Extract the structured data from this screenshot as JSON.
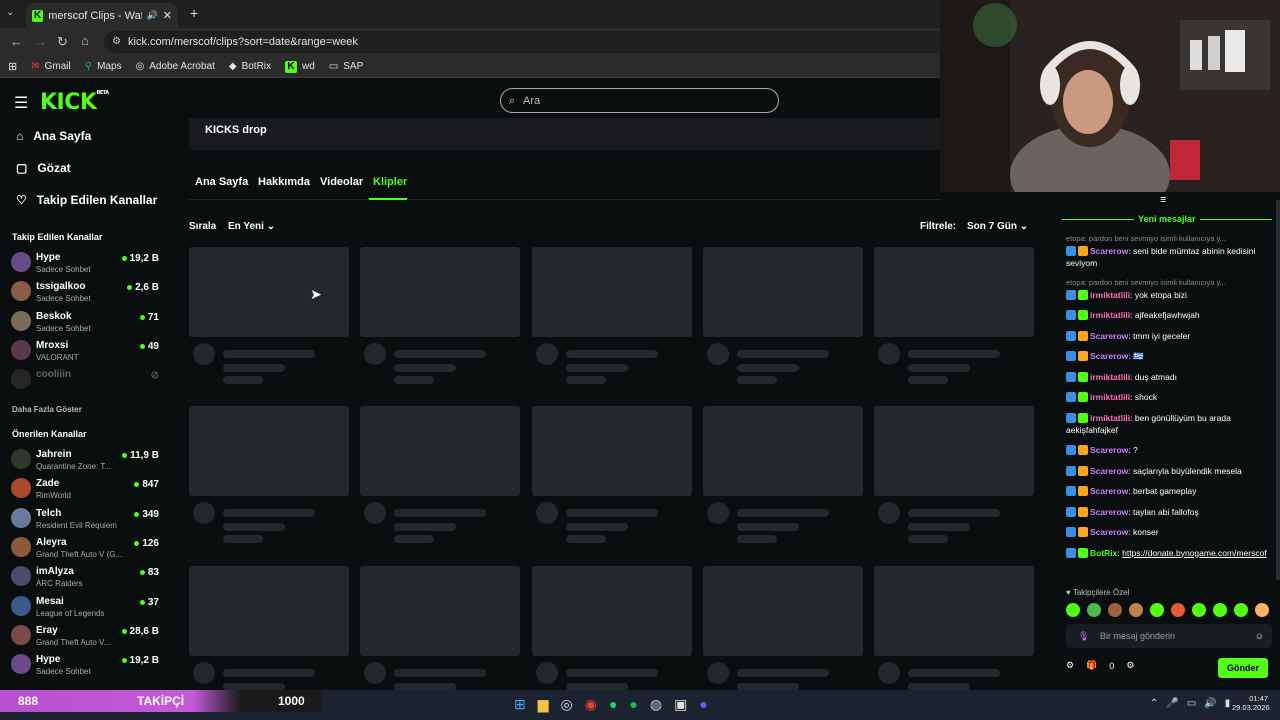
{
  "browser": {
    "tab_title": "merscof Clips - Watch Live",
    "url": "kick.com/merscof/clips?sort=date&range=week",
    "bookmarks": [
      "Gmail",
      "Maps",
      "Adobe Acrobat",
      "BotRix",
      "wd",
      "SAP"
    ]
  },
  "header": {
    "logo": "KICK",
    "logo_badge": "BETA",
    "search_placeholder": "Ara"
  },
  "sidebar": {
    "nav": [
      "Ana Sayfa",
      "Gözat",
      "Takip Edilen Kanallar"
    ],
    "followed_title": "Takip Edilen Kanallar",
    "followed": [
      {
        "name": "Hype",
        "game": "Sadece Sohbet",
        "viewers": "19,2 B",
        "color": "#6b4a8a"
      },
      {
        "name": "tssigalkoo",
        "game": "Sadece Sohbet",
        "viewers": "2,6 B",
        "color": "#8a5a4a"
      },
      {
        "name": "Beskok",
        "game": "Sadece Sohbet",
        "viewers": "71",
        "color": "#7a6a5a"
      },
      {
        "name": "Mroxsi",
        "game": "VALORANT",
        "viewers": "49",
        "color": "#5a3a4a"
      },
      {
        "name": "cooliiin",
        "game": "",
        "viewers": "",
        "color": "#555555"
      }
    ],
    "show_more": "Daha Fazla Göster",
    "recommended_title": "Önerilen Kanallar",
    "recommended": [
      {
        "name": "Jahrein",
        "game": "Quarantine Zone: T...",
        "viewers": "11,9 B",
        "color": "#2a3a2a"
      },
      {
        "name": "Zade",
        "game": "RimWorld",
        "viewers": "847",
        "color": "#aa4a2a"
      },
      {
        "name": "Telch",
        "game": "Resident Evil Requiem",
        "viewers": "349",
        "color": "#6a7a9a"
      },
      {
        "name": "Aleyra",
        "game": "Grand Theft Auto V (G...",
        "viewers": "126",
        "color": "#8a5a3a"
      },
      {
        "name": "imAlyza",
        "game": "ARC Raiders",
        "viewers": "83",
        "color": "#4a4a6a"
      },
      {
        "name": "Mesai",
        "game": "League of Legends",
        "viewers": "37",
        "color": "#3a5a8a"
      },
      {
        "name": "Eray",
        "game": "Grand Theft Auto V...",
        "viewers": "28,6 B",
        "color": "#7a4a4a"
      },
      {
        "name": "Hype",
        "game": "Sadece Sohbet",
        "viewers": "19,2 B",
        "color": "#6b4a8a"
      }
    ]
  },
  "main": {
    "kicks_drop": "KICKS drop",
    "tabs": [
      "Ana Sayfa",
      "Hakkımda",
      "Videolar",
      "Klipler"
    ],
    "sort_label": "Sırala",
    "sort_value": "En Yeni",
    "filter_label": "Filtrele:",
    "filter_value": "Son 7 Gün"
  },
  "chat": {
    "new_messages": "Yeni mesajlar",
    "messages": [
      {
        "reply": "etopa: pardon beni sevmiyo isimli kullanıcıya y...",
        "user": "Scarerow",
        "color": "#c77dff",
        "text": "seni bide mümtaz abinin kedisini seviyom"
      },
      {
        "reply": "etopa: pardon beni sevmiyo isimli kullanıcıya y...",
        "user": "irmiktatlili",
        "color": "#ff6fb5",
        "text": "yok etopa bizi"
      },
      {
        "user": "irmiktatlili",
        "color": "#ff6fb5",
        "text": "ajfeakefjawhwjah"
      },
      {
        "user": "Scarerow",
        "color": "#c77dff",
        "text": "tmm iyi geceler"
      },
      {
        "user": "Scarerow",
        "color": "#c77dff",
        "text": "🇬🇷"
      },
      {
        "user": "irmiktatlili",
        "color": "#ff6fb5",
        "text": "duş atmadı"
      },
      {
        "user": "irmiktatlili",
        "color": "#ff6fb5",
        "text": "shock"
      },
      {
        "user": "irmiktatlili",
        "color": "#ff6fb5",
        "text": "ben gönüllüyüm bu arada aekişfahfajkef"
      },
      {
        "user": "Scarerow",
        "color": "#c77dff",
        "text": "?"
      },
      {
        "user": "Scarerow",
        "color": "#c77dff",
        "text": "saçlarıyla büyülendik mesela"
      },
      {
        "user": "Scarerow",
        "color": "#c77dff",
        "text": "berbat gameplay"
      },
      {
        "user": "Scarerow",
        "color": "#c77dff",
        "text": "taylan abi fallofoş"
      },
      {
        "user": "Scarerow",
        "color": "#c77dff",
        "text": "konser"
      },
      {
        "user": "BotRix",
        "color": "#53fc18",
        "text": "https://donate.bynogame.com/merscof"
      }
    ],
    "followers_only": "Takipçilere Özel",
    "input_placeholder": "Bir mesaj gönderin",
    "points": "0",
    "send_label": "Gönder"
  },
  "overlay": {
    "count": "888",
    "label": "TAKİPÇİ",
    "goal": "1000"
  },
  "taskbar": {
    "time": "01:47",
    "date": "29.03.2026"
  }
}
